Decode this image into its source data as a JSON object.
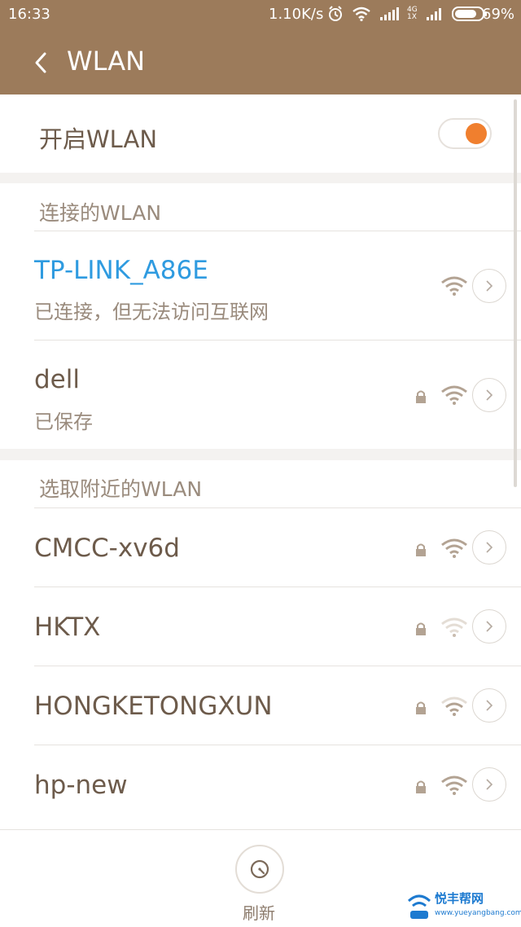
{
  "status_bar": {
    "time": "16:33",
    "speed": "1.10K/s",
    "network_label_top": "4G",
    "network_label_bottom": "1X",
    "battery": "69%"
  },
  "app_bar": {
    "title": "WLAN"
  },
  "wlan_toggle": {
    "label": "开启WLAN",
    "enabled": true
  },
  "connected": {
    "header": "连接的WLAN",
    "items": [
      {
        "name": "TP-LINK_A86E",
        "status": "已连接，但无法访问互联网",
        "locked": false,
        "signal": "strong"
      },
      {
        "name": "dell",
        "status": "已保存",
        "locked": true,
        "signal": "strong"
      }
    ]
  },
  "nearby": {
    "header": "选取附近的WLAN",
    "items": [
      {
        "name": "CMCC-xv6d",
        "locked": true,
        "signal": "strong"
      },
      {
        "name": "HKTX",
        "locked": true,
        "signal": "weak"
      },
      {
        "name": "HONGKETONGXUN",
        "locked": true,
        "signal": "medium"
      },
      {
        "name": "hp-new",
        "locked": true,
        "signal": "strong"
      }
    ]
  },
  "bottom": {
    "refresh_label": "刷新"
  },
  "watermark": {
    "text": "悦丰帮网",
    "url": "www.yueyangbang.com"
  },
  "colors": {
    "header_bg": "#9c7b5b",
    "accent_link": "#2f9be0",
    "toggle_on": "#f07f2e",
    "text_primary": "#6d5b4b",
    "text_secondary": "#9a8b7d"
  }
}
